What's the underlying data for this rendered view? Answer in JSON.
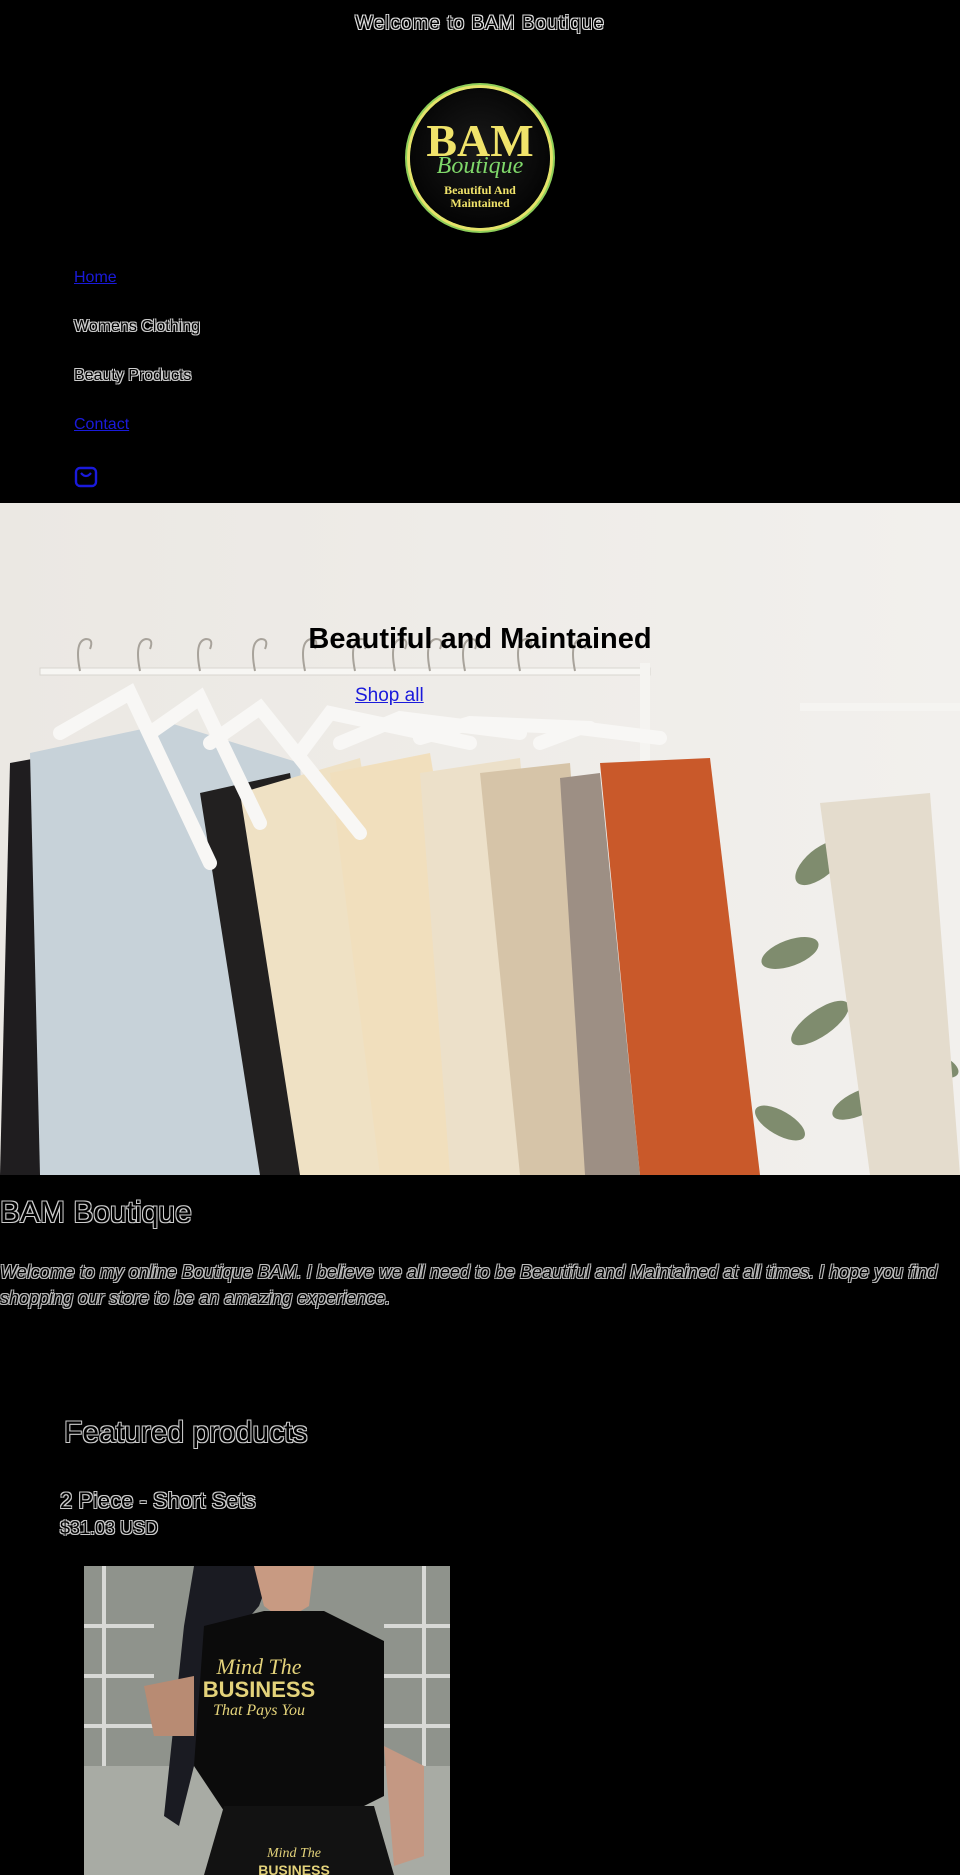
{
  "announcement": "Welcome to BAM Boutique",
  "logo": {
    "line1": "BAM",
    "line2": "Boutique",
    "line3": "Beautiful And",
    "line4": "Maintained"
  },
  "nav": {
    "items": [
      {
        "label": "Home"
      },
      {
        "label": "Womens Clothing"
      },
      {
        "label": "Beauty Products"
      },
      {
        "label": "Contact"
      }
    ],
    "cart_icon": "bag-icon"
  },
  "hero": {
    "title": "Beautiful and Maintained",
    "cta": "Shop all"
  },
  "about": {
    "title": "BAM Boutique",
    "text": "Welcome to my online Boutique BAM. I believe we all need to be Beautiful and Maintained at all times. I hope you find shopping our store to be an amazing experience."
  },
  "featured": {
    "title": "Featured products",
    "product": {
      "name": "2 Piece - Short Sets",
      "price": "$31.03 USD",
      "shirt_line1": "Mind The",
      "shirt_line2": "BUSINESS",
      "shirt_line3": "That Pays You",
      "shorts_line1": "Mind The",
      "shorts_line2": "BUSINESS"
    }
  },
  "colors": {
    "background": "#000000",
    "link": "#1a1adb",
    "logo_gold": "#f0e36a",
    "logo_green": "#7fd86a"
  }
}
